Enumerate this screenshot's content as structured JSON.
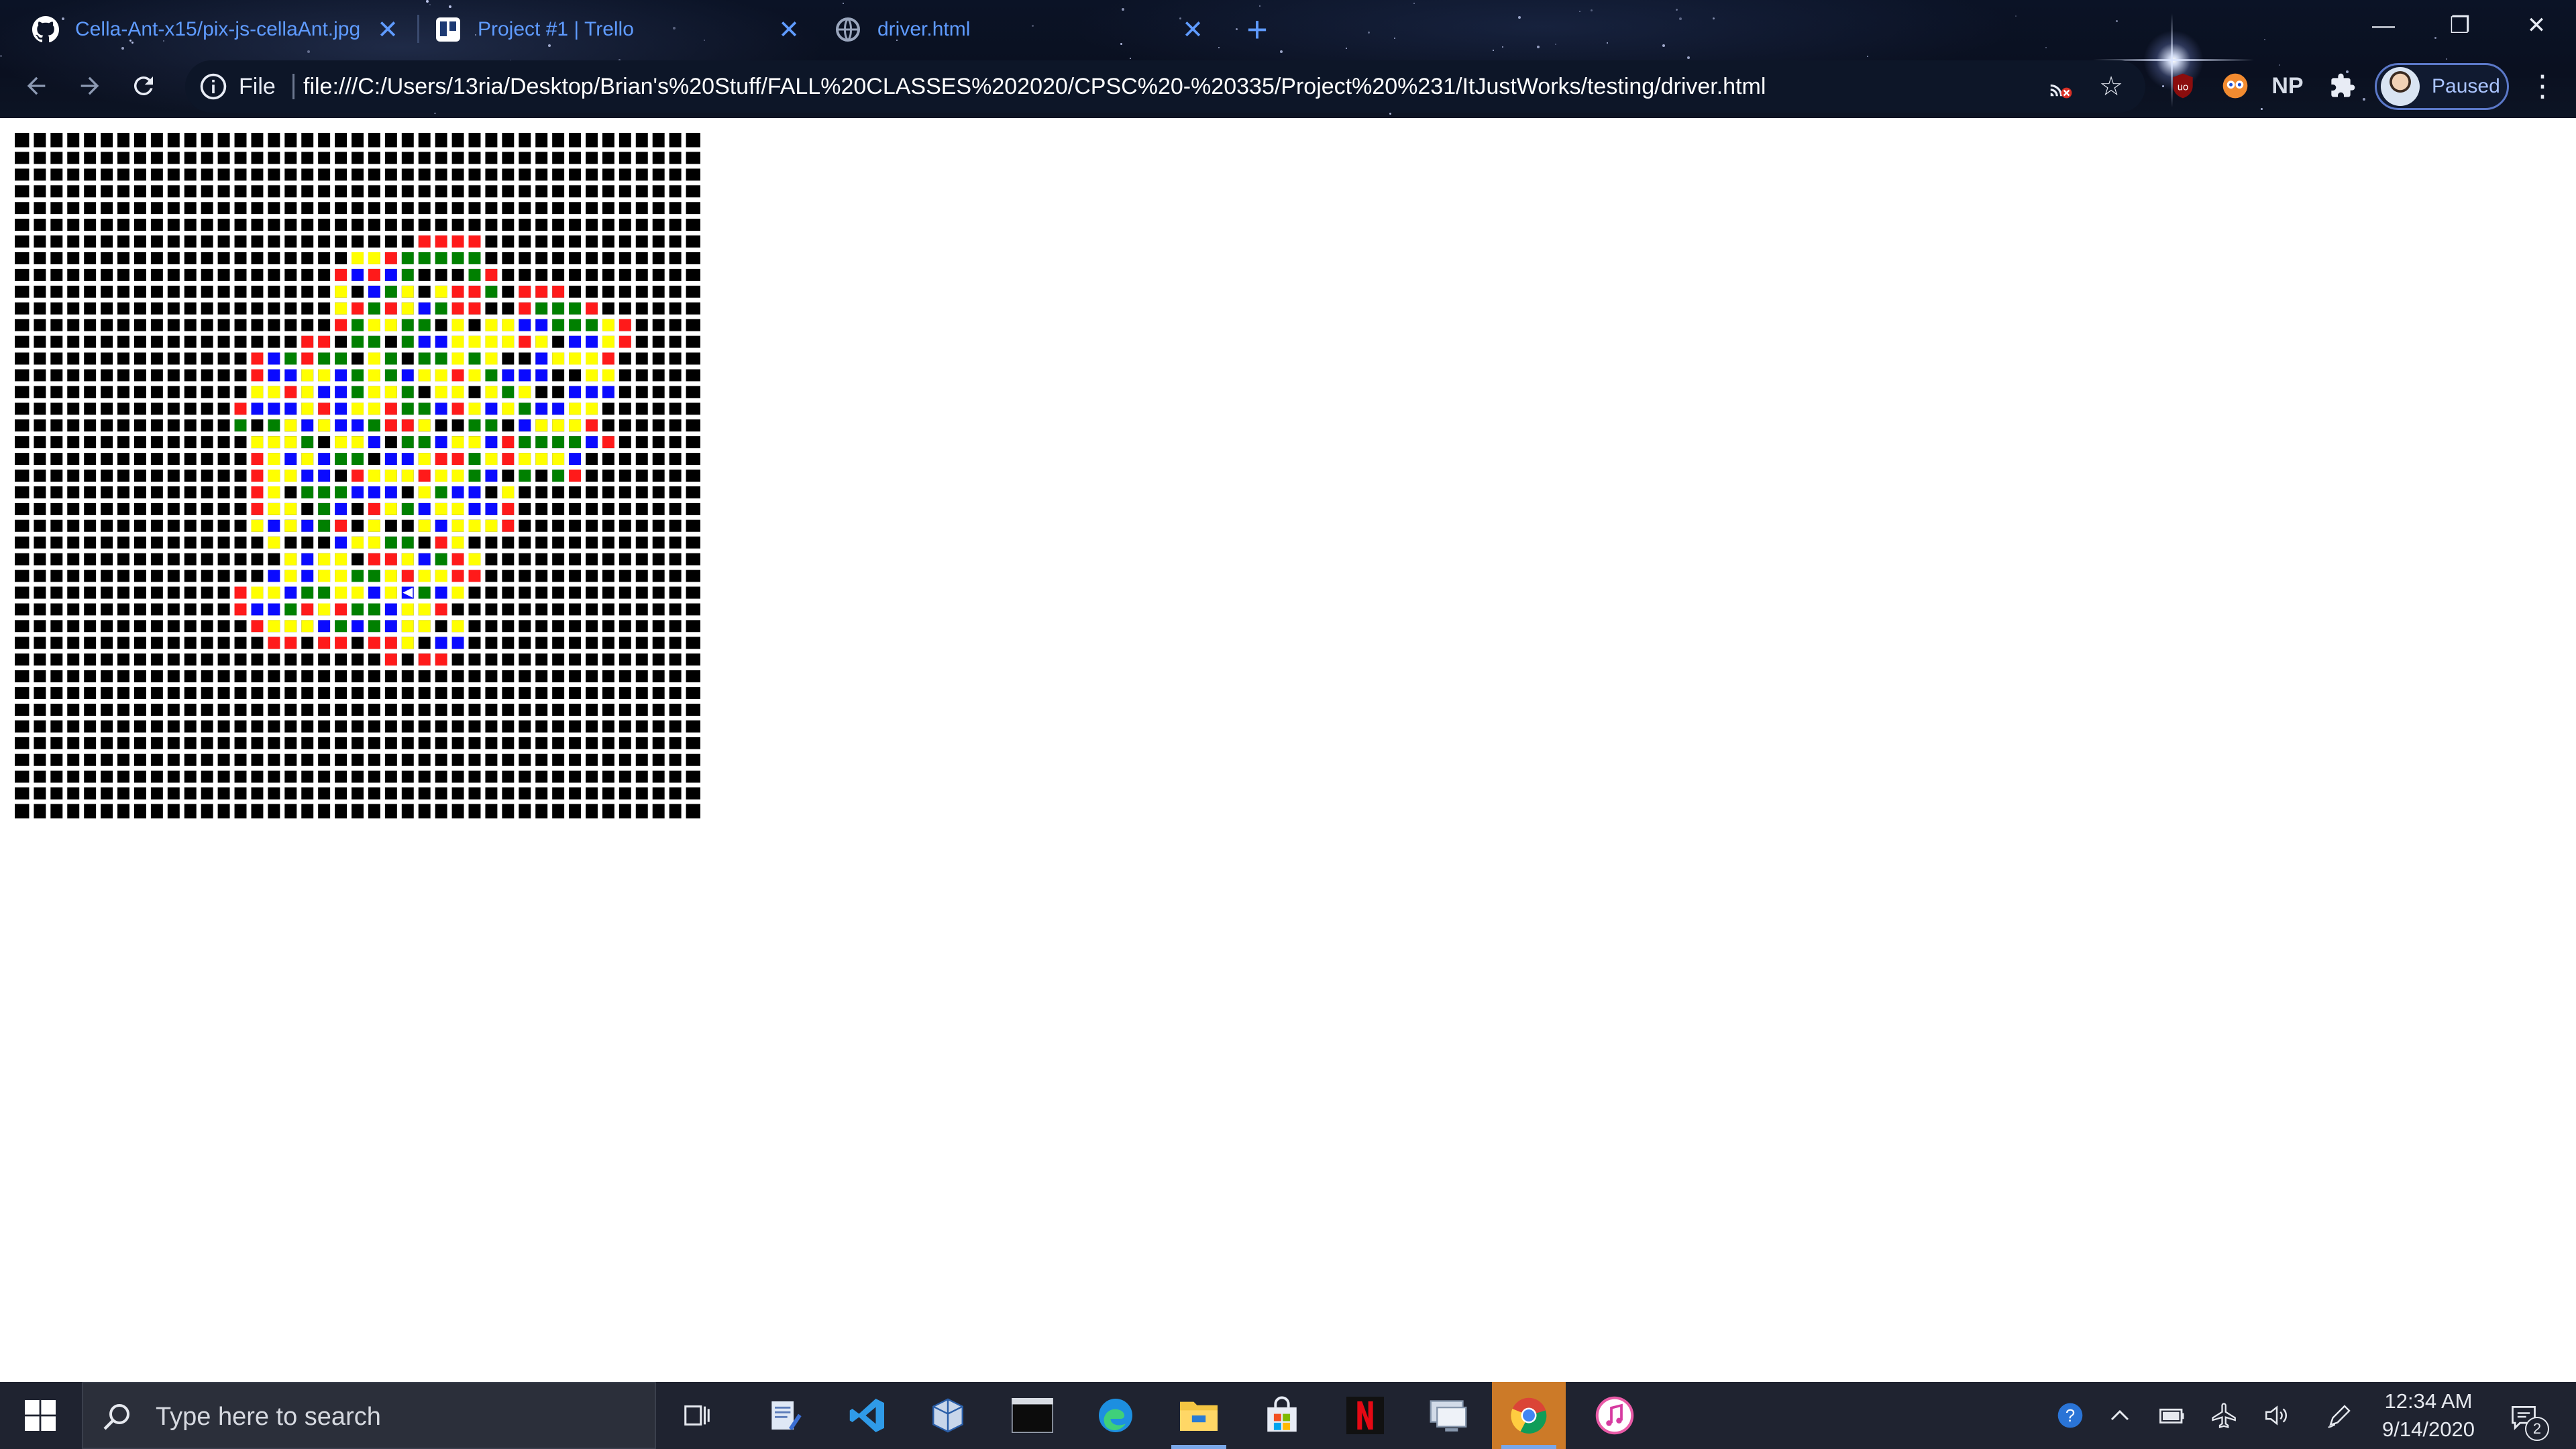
{
  "browser": {
    "tabs": [
      {
        "title": "Cella-Ant-x15/pix-js-cellaAnt.jpg",
        "favicon": "github-icon"
      },
      {
        "title": "Project #1 | Trello",
        "favicon": "trello-icon"
      },
      {
        "title": "driver.html",
        "favicon": "globe-icon"
      }
    ],
    "new_tab_symbol": "+",
    "window_controls": {
      "minimize": "—",
      "restore": "❐",
      "close": "✕"
    },
    "address_bar": {
      "scheme_label": "File",
      "url": "file:///C:/Users/13ria/Desktop/Brian's%20Stuff/FALL%20CLASSES%202020/CPSC%20-%20335/Project%20%231/ItJustWorks/testing/driver.html"
    },
    "extensions": {
      "np_label": "NP"
    },
    "profile": {
      "label": "Paused"
    }
  },
  "grid": {
    "size": 41,
    "palette": {
      "0": "#000000",
      "1": "#ff1a1a",
      "2": "#ffff00",
      "3": "#0a0aff",
      "4": "#008000"
    },
    "ant_row": 27,
    "ant_col": 23,
    "rows": [
      ".........................................",
      ".........................................",
      ".........................................",
      ".........................................",
      ".........................................",
      ".........................................",
      "........................1111.............",
      "....................22144444.............",
      "...................1313400041............",
      "...................2034202114.111........",
      "...................2141234110014441......",
      "...................142244020223344421....",
      ".................11044043322221203321....",
      "..............1341440240442420032221.....",
      "..............1332234243221243330022.....",
      "..............2212334224022024200333.....",
      ".............1333213221443123243322......",
      ".............4042323341120044032221......",
      "..............2224022304432231444431.....",
      "..............1232344033211421222300.....",
      "..............12233012221224304041.......",
      "..............12044433302433020..........",
      "..............1220430124322331...........",
      "..............2323410200232221...........",
      "...............20003224401200............",
      "................232201123412.............",
      "...............3232244212211.............",
      ".............12234422323432..............",
      ".............1334121443221...............",
      "..............1222343432202..............",
      "...............11.11.112.33..............",
      "......................1.11...............",
      ".........................................",
      ".........................................",
      ".........................................",
      ".........................................",
      ".........................................",
      ".........................................",
      ".........................................",
      ".........................................",
      "........................................."
    ]
  },
  "taskbar": {
    "search_placeholder": "Type here to search",
    "apps": [
      "task-view-icon",
      "notepad-icon",
      "vscode-icon",
      "virtualbox-icon",
      "terminal-icon",
      "edge-icon",
      "file-explorer-icon",
      "store-icon",
      "netflix-icon",
      "remote-desktop-icon",
      "chrome-icon",
      "itunes-icon"
    ],
    "clock": {
      "time": "12:34 AM",
      "date": "9/14/2020"
    },
    "notification_count": "2"
  },
  "colors": {
    "tab_text": "#5f9bff",
    "taskbar_bg": "#1f2330",
    "active_app": "#cc7a28"
  }
}
